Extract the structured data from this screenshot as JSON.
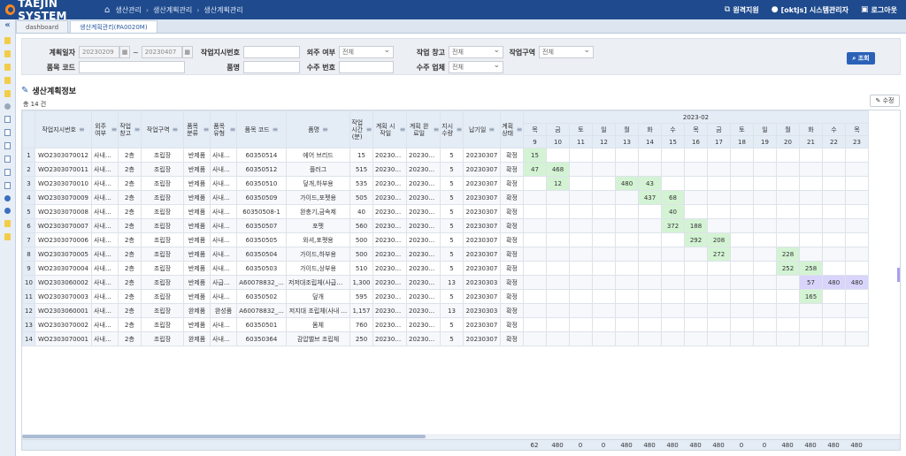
{
  "app": {
    "logo": "TAEJIN SYSTEM",
    "breadcrumb": [
      "생산관리",
      "생산계획관리",
      "생산계획관리"
    ],
    "remote_support": "원격지원",
    "user": "[oktjs] 시스템관리자",
    "logout": "로그아웃"
  },
  "tabs": [
    {
      "label": "dashboard"
    },
    {
      "label": "생산계획관리(PA0020M)"
    }
  ],
  "search": {
    "plan_date_label": "계획일자",
    "date_from": "20230209",
    "date_to": "20230407",
    "date_sep": "~",
    "work_order_label": "작업지시번호",
    "work_order_value": "",
    "outsource_label": "외주 여부",
    "outsource_value": "전체",
    "work_warehouse_label": "작업 창고",
    "work_warehouse_value": "전체",
    "work_area_label": "작업구역",
    "work_area_value": "전체",
    "item_code_label": "품목 코드",
    "item_code_value": "",
    "item_name_label": "품명",
    "item_name_value": "",
    "order_no_label": "수주 번호",
    "order_no_value": "",
    "order_company_label": "수주 업체",
    "order_company_value": "전체",
    "search_button": "조회"
  },
  "section": {
    "title": "생산계획정보",
    "total": "총 14 건",
    "edit_button": "수정"
  },
  "grid": {
    "columns": [
      "작업지시번호",
      "외주 여부",
      "작업 창고",
      "작업구역",
      "품목 분류",
      "품목 유형",
      "품목 코드",
      "품명",
      "작업 시간 (분)",
      "계획 시작일",
      "계획 완료일",
      "지시 수량",
      "납기일",
      "계획 상태"
    ],
    "month_label": "2023-02",
    "days": [
      {
        "wd": "목",
        "d": "9",
        "cls": ""
      },
      {
        "wd": "금",
        "d": "10",
        "cls": ""
      },
      {
        "wd": "토",
        "d": "11",
        "cls": "sat"
      },
      {
        "wd": "일",
        "d": "12",
        "cls": "sun"
      },
      {
        "wd": "월",
        "d": "13",
        "cls": ""
      },
      {
        "wd": "화",
        "d": "14",
        "cls": ""
      },
      {
        "wd": "수",
        "d": "15",
        "cls": ""
      },
      {
        "wd": "목",
        "d": "16",
        "cls": ""
      },
      {
        "wd": "금",
        "d": "17",
        "cls": ""
      },
      {
        "wd": "토",
        "d": "18",
        "cls": "sat"
      },
      {
        "wd": "일",
        "d": "19",
        "cls": "sun"
      },
      {
        "wd": "월",
        "d": "20",
        "cls": ""
      },
      {
        "wd": "화",
        "d": "21",
        "cls": ""
      },
      {
        "wd": "수",
        "d": "22",
        "cls": ""
      },
      {
        "wd": "목",
        "d": "23",
        "cls": ""
      }
    ],
    "rows": [
      {
        "n": "1",
        "wo": "WO2303070012",
        "os": "사내작업",
        "wh": "2층",
        "area": "조립장",
        "cls": "반제품",
        "type": "사내조립",
        "code": "60350514",
        "name": "에어 브리드",
        "time": "15",
        "start": "20230209",
        "end": "20230209",
        "qty": "5",
        "due": "20230307",
        "status": "확정",
        "cells": [
          "15",
          "",
          "",
          "",
          "",
          "",
          "",
          "",
          "",
          "",
          "",
          "",
          "",
          "",
          ""
        ],
        "color": "g"
      },
      {
        "n": "2",
        "wo": "WO2303070011",
        "os": "사내작업",
        "wh": "2층",
        "area": "조립장",
        "cls": "반제품",
        "type": "사내조립",
        "code": "60350512",
        "name": "플러그",
        "time": "515",
        "start": "20230209",
        "end": "20230210",
        "qty": "5",
        "due": "20230307",
        "status": "확정",
        "cells": [
          "47",
          "468",
          "",
          "",
          "",
          "",
          "",
          "",
          "",
          "",
          "",
          "",
          "",
          "",
          ""
        ],
        "color": "g"
      },
      {
        "n": "3",
        "wo": "WO2303070010",
        "os": "사내작업",
        "wh": "2층",
        "area": "조립장",
        "cls": "반제품",
        "type": "사내조립",
        "code": "60350510",
        "name": "덮개,하부용",
        "time": "535",
        "start": "20230210",
        "end": "20230214",
        "qty": "5",
        "due": "20230307",
        "status": "확정",
        "cells": [
          "",
          "12",
          "",
          "",
          "480",
          "43",
          "",
          "",
          "",
          "",
          "",
          "",
          "",
          "",
          ""
        ],
        "color": "g"
      },
      {
        "n": "4",
        "wo": "WO2303070009",
        "os": "사내작업",
        "wh": "2층",
        "area": "조립장",
        "cls": "반제품",
        "type": "사내조립",
        "code": "60350509",
        "name": "가이드,포펫용",
        "time": "505",
        "start": "20230214",
        "end": "20230215",
        "qty": "5",
        "due": "20230307",
        "status": "확정",
        "cells": [
          "",
          "",
          "",
          "",
          "",
          "437",
          "68",
          "",
          "",
          "",
          "",
          "",
          "",
          "",
          ""
        ],
        "color": "g"
      },
      {
        "n": "5",
        "wo": "WO2303070008",
        "os": "사내작업",
        "wh": "2층",
        "area": "조립장",
        "cls": "반제품",
        "type": "사내조립",
        "code": "60350508-1",
        "name": "완충기,금속제",
        "time": "40",
        "start": "20230215",
        "end": "20230215",
        "qty": "5",
        "due": "20230307",
        "status": "확정",
        "cells": [
          "",
          "",
          "",
          "",
          "",
          "",
          "40",
          "",
          "",
          "",
          "",
          "",
          "",
          "",
          ""
        ],
        "color": "g"
      },
      {
        "n": "6",
        "wo": "WO2303070007",
        "os": "사내작업",
        "wh": "2층",
        "area": "조립장",
        "cls": "반제품",
        "type": "사내조립",
        "code": "60350507",
        "name": "포펫",
        "time": "560",
        "start": "20230215",
        "end": "20230216",
        "qty": "5",
        "due": "20230307",
        "status": "확정",
        "cells": [
          "",
          "",
          "",
          "",
          "",
          "",
          "372",
          "188",
          "",
          "",
          "",
          "",
          "",
          "",
          ""
        ],
        "color": "g"
      },
      {
        "n": "7",
        "wo": "WO2303070006",
        "os": "사내작업",
        "wh": "2층",
        "area": "조립장",
        "cls": "반제품",
        "type": "사내조립",
        "code": "60350505",
        "name": "와셔,포펫용",
        "time": "500",
        "start": "20230216",
        "end": "20230217",
        "qty": "5",
        "due": "20230307",
        "status": "확정",
        "cells": [
          "",
          "",
          "",
          "",
          "",
          "",
          "",
          "292",
          "208",
          "",
          "",
          "",
          "",
          "",
          ""
        ],
        "color": "g"
      },
      {
        "n": "8",
        "wo": "WO2303070005",
        "os": "사내작업",
        "wh": "2층",
        "area": "조립장",
        "cls": "반제품",
        "type": "사내조립",
        "code": "60350504",
        "name": "가이드,하부용",
        "time": "500",
        "start": "20230217",
        "end": "20230220",
        "qty": "5",
        "due": "20230307",
        "status": "확정",
        "cells": [
          "",
          "",
          "",
          "",
          "",
          "",
          "",
          "",
          "272",
          "",
          "",
          "228",
          "",
          "",
          ""
        ],
        "color": "g"
      },
      {
        "n": "9",
        "wo": "WO2303070004",
        "os": "사내작업",
        "wh": "2층",
        "area": "조립장",
        "cls": "반제품",
        "type": "사내조립",
        "code": "60350503",
        "name": "가이드,상부용",
        "time": "510",
        "start": "20230220",
        "end": "20230221",
        "qty": "5",
        "due": "20230307",
        "status": "확정",
        "cells": [
          "",
          "",
          "",
          "",
          "",
          "",
          "",
          "",
          "",
          "",
          "",
          "252",
          "258",
          "",
          ""
        ],
        "color": "g"
      },
      {
        "n": "10",
        "wo": "WO2303060002",
        "os": "사내작업",
        "wh": "2층",
        "area": "조립장",
        "cls": "반제품",
        "type": "사급완...",
        "code": "A60078832_...",
        "name": "저저대조립체(사급완...",
        "time": "1,300",
        "start": "20230221",
        "end": "20230224",
        "qty": "13",
        "due": "20230303",
        "status": "확정",
        "cells": [
          "",
          "",
          "",
          "",
          "",
          "",
          "",
          "",
          "",
          "",
          "",
          "",
          "57",
          "480",
          "480"
        ],
        "color": "p"
      },
      {
        "n": "11",
        "wo": "WO2303070003",
        "os": "사내작업",
        "wh": "2층",
        "area": "조립장",
        "cls": "반제품",
        "type": "사내조립",
        "code": "60350502",
        "name": "덮개",
        "time": "595",
        "start": "20230221",
        "end": "20230301",
        "qty": "5",
        "due": "20230307",
        "status": "확정",
        "cells": [
          "",
          "",
          "",
          "",
          "",
          "",
          "",
          "",
          "",
          "",
          "",
          "",
          "165",
          "",
          ""
        ],
        "color": "g"
      },
      {
        "n": "12",
        "wo": "WO2303060001",
        "os": "사내작업",
        "wh": "2층",
        "area": "조립장",
        "cls": "완제품",
        "type": "완성품",
        "code": "A60078832_...",
        "name": "저지대 조립체(사내 ...",
        "time": "1,157",
        "start": "20230224",
        "end": "20230228",
        "qty": "13",
        "due": "20230303",
        "status": "확정",
        "cells": [
          "",
          "",
          "",
          "",
          "",
          "",
          "",
          "",
          "",
          "",
          "",
          "",
          "",
          "",
          ""
        ],
        "color": "p"
      },
      {
        "n": "13",
        "wo": "WO2303070002",
        "os": "사내작업",
        "wh": "2층",
        "area": "조립장",
        "cls": "반제품",
        "type": "사내조립",
        "code": "60350501",
        "name": "몸체",
        "time": "760",
        "start": "20230301",
        "end": "20230303",
        "qty": "5",
        "due": "20230307",
        "status": "확정",
        "cells": [
          "",
          "",
          "",
          "",
          "",
          "",
          "",
          "",
          "",
          "",
          "",
          "",
          "",
          "",
          ""
        ],
        "color": "g"
      },
      {
        "n": "14",
        "wo": "WO2303070001",
        "os": "사내작업",
        "wh": "2층",
        "area": "조립장",
        "cls": "완제품",
        "type": "사내조립",
        "code": "60350364",
        "name": "감압밸브 조립체",
        "time": "250",
        "start": "20230303",
        "end": "20230303",
        "qty": "5",
        "due": "20230307",
        "status": "확정",
        "cells": [
          "",
          "",
          "",
          "",
          "",
          "",
          "",
          "",
          "",
          "",
          "",
          "",
          "",
          "",
          ""
        ],
        "color": "g"
      }
    ],
    "totals": [
      "62",
      "480",
      "0",
      "0",
      "480",
      "480",
      "480",
      "480",
      "480",
      "0",
      "0",
      "480",
      "480",
      "480",
      "480"
    ]
  }
}
